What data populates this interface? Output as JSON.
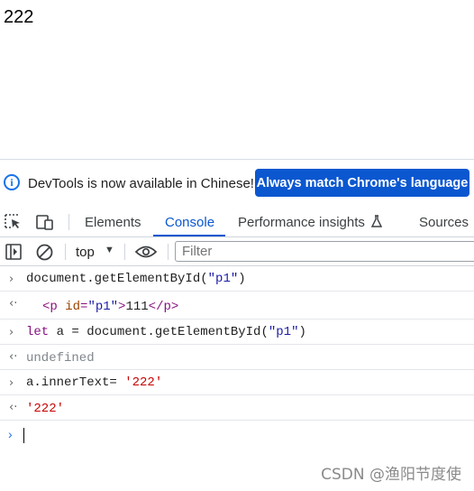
{
  "page": {
    "content_text": "222"
  },
  "infobar": {
    "message": "DevTools is now available in Chinese!",
    "button_label": "Always match Chrome's language"
  },
  "tabs": {
    "items": [
      {
        "label": "Elements"
      },
      {
        "label": "Console"
      },
      {
        "label": "Performance insights"
      },
      {
        "label": "Sources"
      }
    ],
    "active": "Console"
  },
  "toolbar": {
    "context": "top",
    "filter_placeholder": "Filter"
  },
  "console": {
    "line1": {
      "pre": "document.getElementById(",
      "str": "\"p1\"",
      "post": ")"
    },
    "line2": {
      "open": "<p",
      "attr": " id",
      "eq": "=",
      "val": "\"p1\"",
      "close": ">",
      "text": "111",
      "end": "</p>"
    },
    "line3": {
      "kw": "let",
      "mid": " a = document.getElementById(",
      "str": "\"p1\"",
      "post": ")"
    },
    "line4": {
      "text": "undefined"
    },
    "line5": {
      "pre": "a.innerText= ",
      "str": "'222'"
    },
    "line6": {
      "text": "'222'"
    }
  },
  "watermark": "CSDN @渔阳节度使",
  "colors": {
    "accent": "#0b57d0",
    "keyword": "#881280",
    "string": "#1a1aa6",
    "result_string": "#c80000"
  },
  "icons": [
    "info-icon",
    "inspect-element-icon",
    "device-toolbar-icon",
    "flask-icon",
    "sidebar-toggle-icon",
    "clear-console-icon",
    "dropdown-arrow-icon",
    "eye-icon",
    "chevron-right-icon",
    "return-arrow-icon"
  ]
}
